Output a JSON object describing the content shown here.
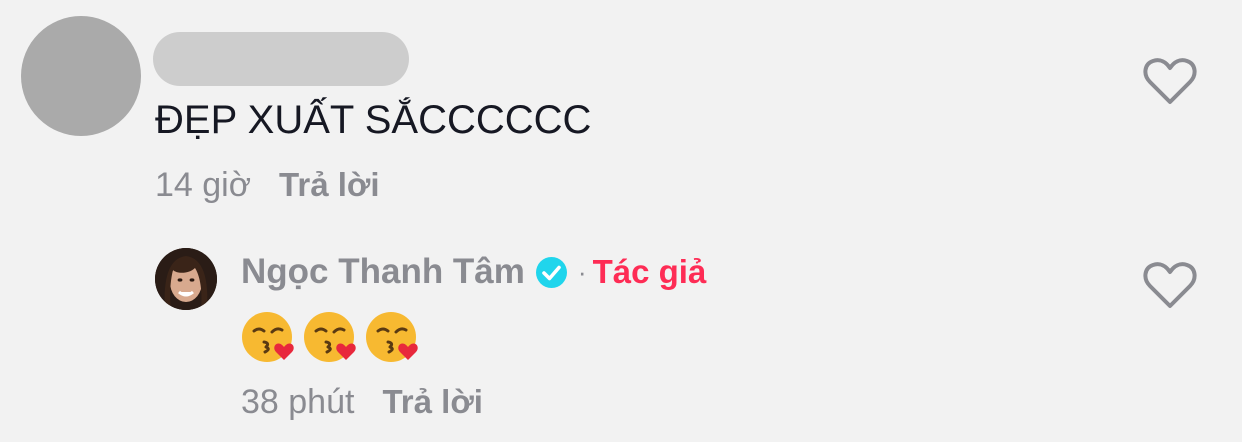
{
  "comment": {
    "text": "ĐẸP XUẤT SẮCCCCCC",
    "time": "14 giờ",
    "reply_label": "Trả lời",
    "icons": {
      "avatar": "avatar-placeholder",
      "like": "heart-outline-icon"
    }
  },
  "reply": {
    "author": "Ngọc Thanh Tâm",
    "separator": "·",
    "author_tag": "Tác giả",
    "emoji_icons": [
      "kissing-face-with-heart-emoji",
      "kissing-face-with-heart-emoji",
      "kissing-face-with-heart-emoji"
    ],
    "time": "38 phút",
    "reply_label": "Trả lời",
    "icons": {
      "verified": "verified-check-icon",
      "like": "heart-outline-icon"
    }
  },
  "colors": {
    "background": "#f2f2f2",
    "text_primary": "#161823",
    "text_secondary": "#8a8b91",
    "author_tag": "#fe2c55",
    "verified": "#20d5ec"
  }
}
